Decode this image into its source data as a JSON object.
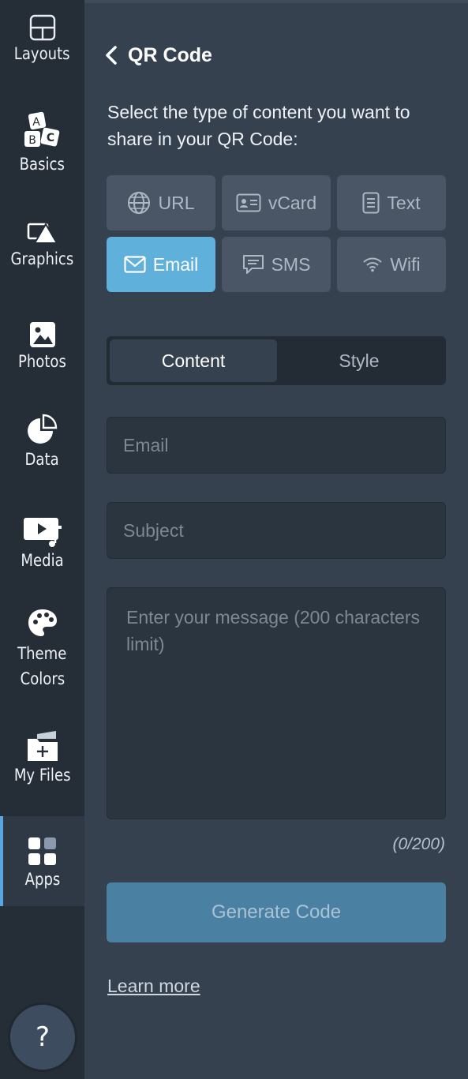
{
  "sidebar": {
    "items": [
      {
        "label": "Layouts",
        "icon": "layouts-icon"
      },
      {
        "label": "Basics",
        "icon": "abc-blocks-icon"
      },
      {
        "label": "Graphics",
        "icon": "shapes-icon"
      },
      {
        "label": "Photos",
        "icon": "photo-icon"
      },
      {
        "label": "Data",
        "icon": "pie-chart-icon"
      },
      {
        "label": "Media",
        "icon": "video-music-icon"
      },
      {
        "label": "Theme",
        "label2": "Colors",
        "icon": "palette-icon"
      },
      {
        "label": "My Files",
        "icon": "folder-plus-icon"
      },
      {
        "label": "Apps",
        "icon": "apps-grid-icon",
        "active": true
      }
    ],
    "help_label": "?",
    "block_letters": [
      "A",
      "B",
      "C"
    ]
  },
  "panel": {
    "title": "QR Code",
    "description": "Select the type of content you want to share in your QR Code:",
    "types": [
      {
        "label": "URL",
        "icon": "globe-icon"
      },
      {
        "label": "vCard",
        "icon": "id-card-icon"
      },
      {
        "label": "Text",
        "icon": "document-icon"
      },
      {
        "label": "Email",
        "icon": "envelope-icon",
        "selected": true
      },
      {
        "label": "SMS",
        "icon": "chat-bubble-icon"
      },
      {
        "label": "Wifi",
        "icon": "wifi-icon"
      }
    ],
    "tabs": [
      {
        "label": "Content",
        "active": true
      },
      {
        "label": "Style"
      }
    ],
    "email_placeholder": "Email",
    "subject_placeholder": "Subject",
    "message_placeholder": "Enter your message (200 characters limit)",
    "counter": "(0/200)",
    "generate_label": "Generate Code",
    "learn_more": "Learn more"
  },
  "colors": {
    "sidebar_bg": "#252d37",
    "panel_bg": "#35414f",
    "accent": "#5fb0db",
    "generate_bg": "#4a80a2"
  }
}
